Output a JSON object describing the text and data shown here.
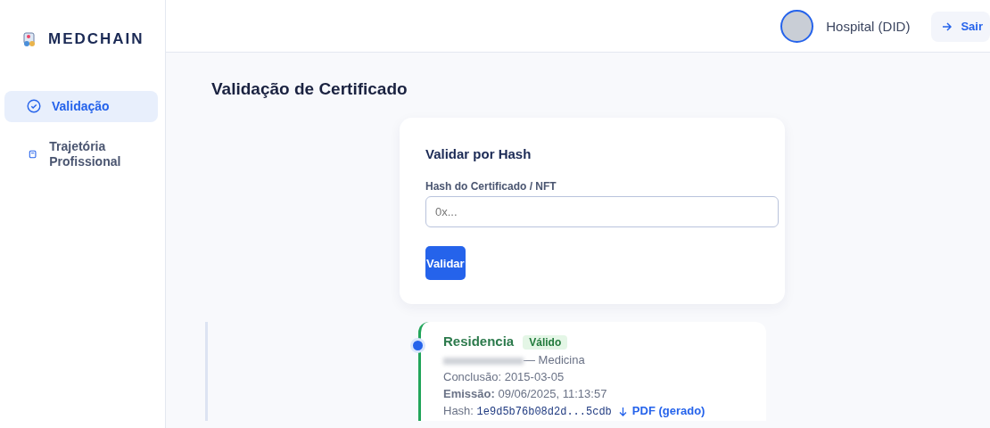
{
  "brand": {
    "name": "MEDCHAIN"
  },
  "sidebar": {
    "items": [
      {
        "label": "Validação",
        "kind": "check",
        "selected": true
      },
      {
        "label": "Trajetória Profissional",
        "kind": "document",
        "selected": false
      }
    ]
  },
  "header": {
    "user": "Hospital (DID)",
    "logout": "Sair"
  },
  "page": {
    "title": "Validação de Certificado"
  },
  "validate_form": {
    "title": "Validar por Hash",
    "label": "Hash do Certificado / NFT",
    "placeholder": "0x...",
    "button": "Validar"
  },
  "certificates": [
    {
      "title": "Residencia",
      "status": "Válido",
      "valid": true,
      "holder_redacted": true,
      "course": "— Medicina",
      "conclusion": "Conclusão: 2015-03-05",
      "issued_label": "Emissão:",
      "issued": "09/06/2025, 11:13:57",
      "hash_label": "Hash:",
      "hash": "1e9d5b76b08d2d...5cdb",
      "pdf": "PDF (gerado)"
    }
  ]
}
